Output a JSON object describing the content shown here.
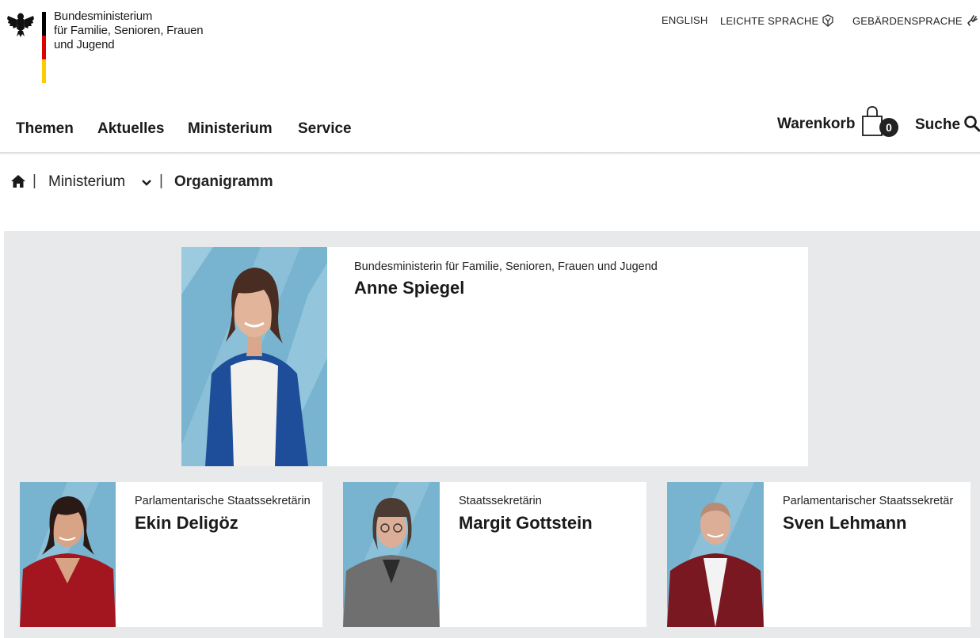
{
  "logo": {
    "line1": "Bundesministerium",
    "line2": "für Familie, Senioren, Frauen",
    "line3": "und Jugend",
    "flag_colors": [
      "#000000",
      "#dd0000",
      "#ffcc00"
    ]
  },
  "top_links": {
    "english": "ENGLISH",
    "leichte_sprache": "LEICHTE SPRACHE",
    "gebaerdensprache": "GEBÄRDENSPRACHE"
  },
  "nav": {
    "items": [
      "Themen",
      "Aktuelles",
      "Ministerium",
      "Service"
    ],
    "cart_label": "Warenkorb",
    "cart_count": "0",
    "search_label": "Suche"
  },
  "breadcrumb": {
    "home_icon": "home-icon",
    "items": [
      "Ministerium",
      "Organigramm"
    ],
    "dropdown_icon": "chevron-down-icon"
  },
  "org": {
    "minister": {
      "role": "Bundesministerin für Familie, Senioren, Frauen und Jugend",
      "name": "Anne Spiegel"
    },
    "secretaries": [
      {
        "role": "Parlamentarische Staatssekretärin",
        "name": "Ekin Deligöz"
      },
      {
        "role": "Staatssekretärin",
        "name": "Margit Gottstein"
      },
      {
        "role": "Parlamentarischer Staatssekretär",
        "name": "Sven Lehmann"
      }
    ]
  },
  "colors": {
    "photo_background": "#78b4cf",
    "org_background": "#e8e9eb",
    "text": "#1a1a1a"
  }
}
